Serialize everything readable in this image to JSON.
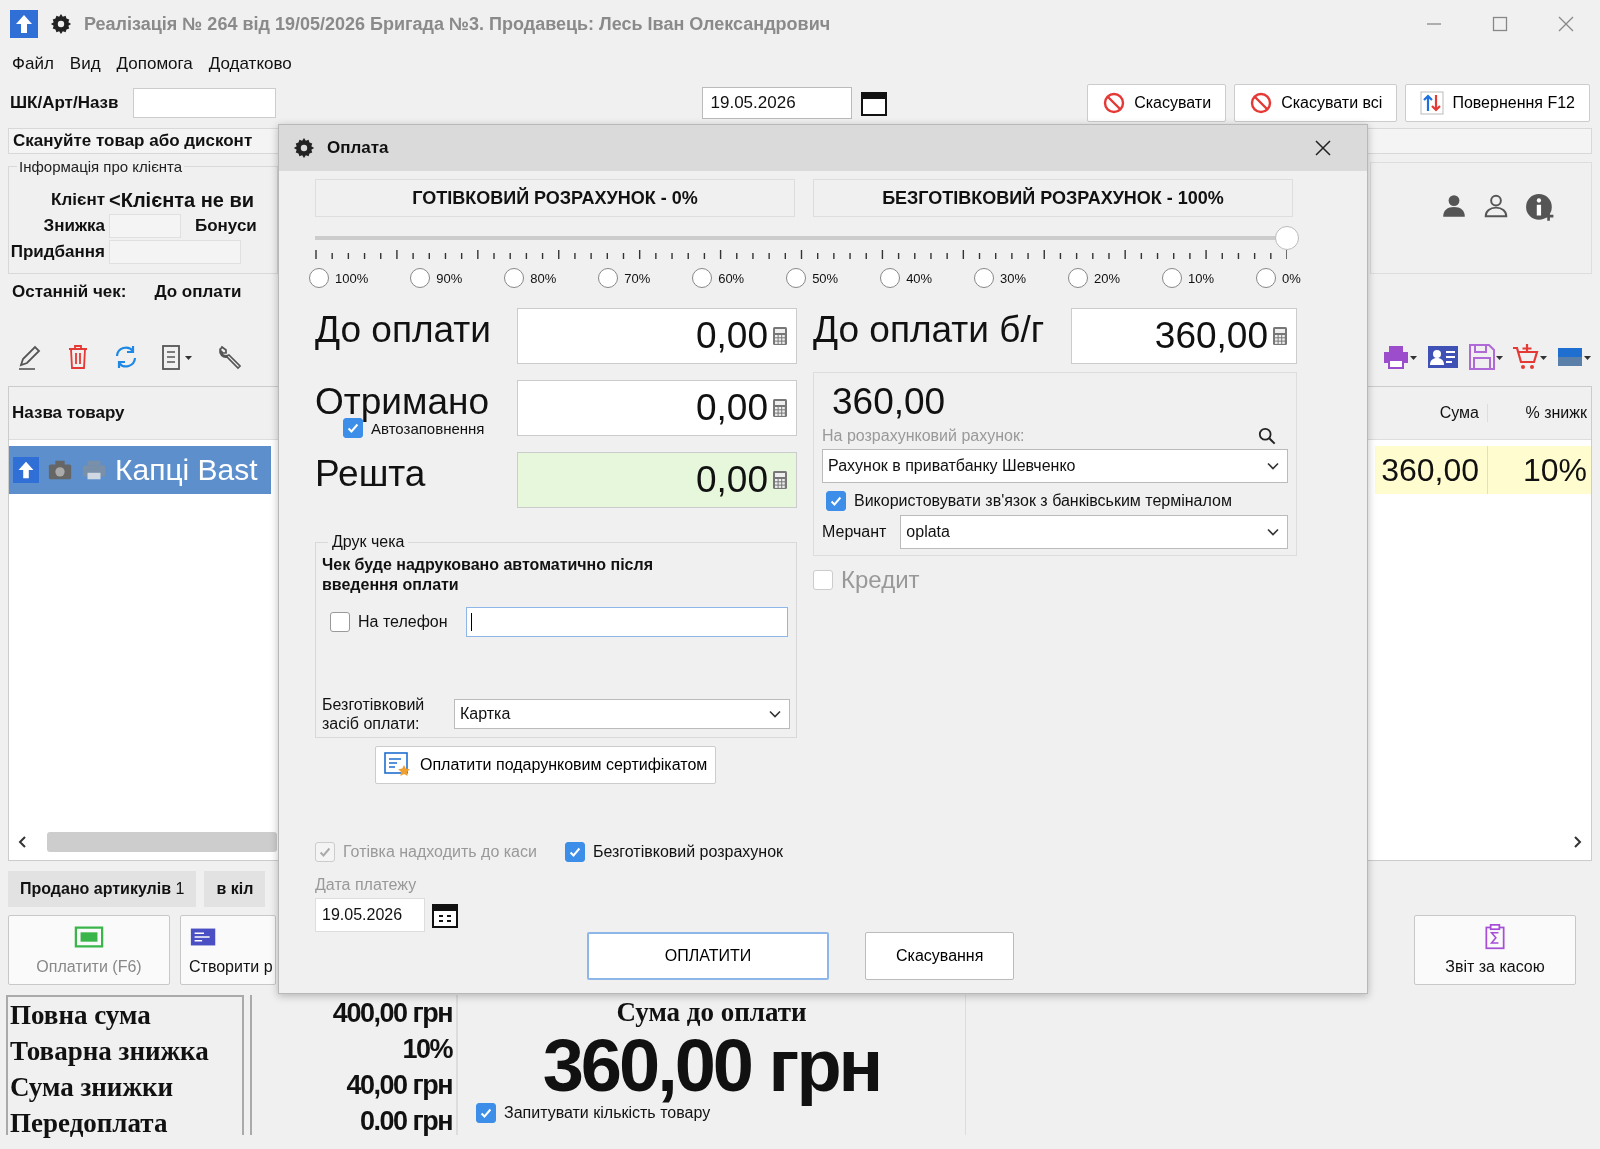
{
  "window": {
    "title": "Реалізація № 264 від 19/05/2026 Бригада №3. Продавець: Лесь Іван Олександрович"
  },
  "menu": [
    "Файл",
    "Вид",
    "Допомога",
    "Додатково"
  ],
  "search": {
    "label": "ШК/Арт/Назв"
  },
  "date_field": {
    "value": "19.05.2026"
  },
  "top_buttons": [
    {
      "label": "Скасувати",
      "kind": "cancel"
    },
    {
      "label": "Скасувати всі",
      "kind": "cancel"
    },
    {
      "label": "Повернення F12",
      "kind": "return"
    }
  ],
  "scan_message": "Скануйте товар або дисконт",
  "client_info": {
    "title": "Інформація про клієнта",
    "client_label": "Клієнт",
    "client_value": "<Клієнта не ви",
    "discount_label": "Знижка",
    "bonus_label": "Бонуси",
    "purchases_label": "Придбання"
  },
  "last_check": {
    "label": "Останній чек:",
    "due_label": "До оплати"
  },
  "table": {
    "columns": [
      "Назва товару",
      "Сума",
      "% знижк"
    ],
    "rows": [
      {
        "name": "Капці Bast",
        "sum": "360,00",
        "discount": "10%",
        "selected": true
      }
    ]
  },
  "counts": [
    {
      "label": "Продано артикулів",
      "value": "1"
    },
    {
      "label": "в кіл"
    }
  ],
  "actions_left": [
    {
      "label": "Оплатити (F6)",
      "kind": "cash",
      "disabled": true
    },
    {
      "label": "Створити р",
      "kind": "doc",
      "disabled": false
    }
  ],
  "actions_right": [
    {
      "label": "Звіт за касою",
      "kind": "report",
      "disabled": false
    }
  ],
  "totals": {
    "rows": [
      {
        "label": "Повна сума",
        "value": "400,00 грн"
      },
      {
        "label": "Товарна знижка",
        "value": "10%"
      },
      {
        "label": "Сума знижки",
        "value": "40,00 грн"
      },
      {
        "label": "Передоплата",
        "value": "0.00 грн"
      }
    ],
    "due_title": "Сума до оплати",
    "due_value": "360,00 грн",
    "ask_quantity": {
      "label": "Запитувати кількість товару",
      "checked": true
    }
  },
  "dialog": {
    "title": "Оплата",
    "cash_header": "ГОТІВКОВИЙ РОЗРАХУНОК - 0%",
    "card_header": "БЕЗГОТІВКОВИЙ РОЗРАХУНОК - 100%",
    "split_slider": {
      "level": 1
    },
    "presets": [
      {
        "label": "100%",
        "selected": false
      },
      {
        "label": "90%",
        "selected": false
      },
      {
        "label": "80%",
        "selected": false
      },
      {
        "label": "70%",
        "selected": false
      },
      {
        "label": "60%",
        "selected": false
      },
      {
        "label": "50%",
        "selected": false
      },
      {
        "label": "40%",
        "selected": false
      },
      {
        "label": "30%",
        "selected": false
      },
      {
        "label": "20%",
        "selected": false
      },
      {
        "label": "10%",
        "selected": false
      },
      {
        "label": "0%",
        "selected": false
      }
    ],
    "amounts": [
      {
        "label": "До оплати",
        "value": "0,00",
        "kind": "plain"
      },
      {
        "label": "Отримано",
        "value": "0,00",
        "kind": "plain"
      },
      {
        "label": "Решта",
        "value": "0,00",
        "kind": "change"
      }
    ],
    "autofill": {
      "label": "Автозаповнення",
      "checked": true
    },
    "print": {
      "title": "Друк чека",
      "note": "Чек буде надруковано автоматично після введення оплати",
      "phone": {
        "label": "На телефон",
        "checked": false
      },
      "cashless_label": "Безготівковий засіб оплати:",
      "cashless_method": "Картка"
    },
    "gift_button": "Оплатити подарунковим сертифікатом",
    "card": {
      "due_label": "До оплати б/г",
      "due_value": "360,00",
      "amount": "360,00",
      "account_label": "На розрахунковий рахунок:",
      "account": "Рахунок в приватбанку Шевченко",
      "terminal": {
        "label": "Використовувати зв'язок з банківським терміналом",
        "checked": true
      },
      "merchant_label": "Мерчант",
      "merchant": "oplata"
    },
    "credit": {
      "label": "Кредит",
      "checked": false,
      "disabled": true
    },
    "cash_to_register": {
      "label": "Готівка надходить до каси",
      "checked": true,
      "disabled": true
    },
    "cashless": {
      "label": "Безготівковий розрахунок",
      "checked": true,
      "disabled": false
    },
    "payment_date": {
      "label": "Дата платежу",
      "value": "19.05.2026"
    },
    "buttons": [
      {
        "label": "ОПЛАТИТИ",
        "focused": true
      },
      {
        "label": "Скасування",
        "focused": false
      }
    ]
  }
}
